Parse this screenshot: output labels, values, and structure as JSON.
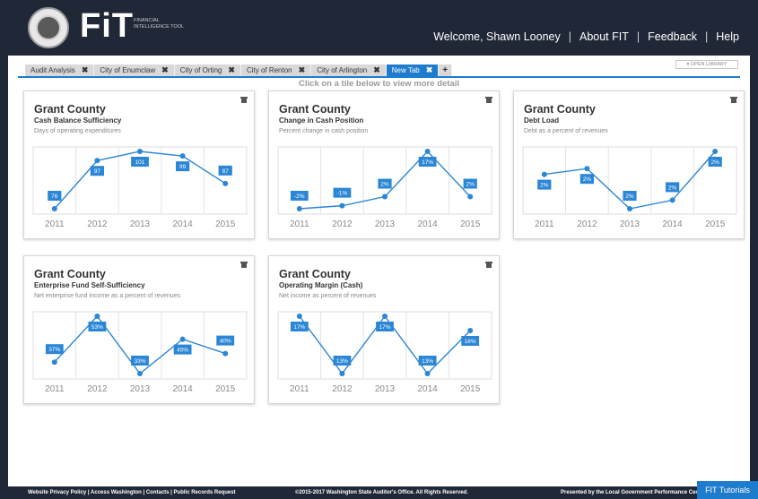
{
  "header": {
    "logo_text": "FiT",
    "logo_subtitle": "FINANCIAL INTELLIGENCE TOOL",
    "nav": [
      "Welcome, Shawn Looney",
      "About FIT",
      "Feedback",
      "Help"
    ],
    "open_library": "▾ OPEN LIBRARY"
  },
  "tabs": [
    {
      "label": "Audit Analysis",
      "close": "✖"
    },
    {
      "label": "City of Enumclaw",
      "close": "✖"
    },
    {
      "label": "City of Orting",
      "close": "✖"
    },
    {
      "label": "City of Renton",
      "close": "✖"
    },
    {
      "label": "City of Arlington",
      "close": "✖"
    },
    {
      "label": "New Tab",
      "close": "✖"
    }
  ],
  "add_tab": "+",
  "hint": "Click on a tile below to view more detail",
  "chart_data": [
    {
      "type": "line",
      "title": "Grant County",
      "subtitle": "Cash Balance Sufficiency",
      "description": "Days of operating expenditures",
      "x": [
        "2011",
        "2012",
        "2013",
        "2014",
        "2015"
      ],
      "values": [
        76,
        97,
        101,
        99,
        87
      ],
      "labels": [
        "76",
        "97",
        "101",
        "99",
        "87"
      ]
    },
    {
      "type": "line",
      "title": "Grant County",
      "subtitle": "Change in Cash Position",
      "description": "Percent change in cash position",
      "x": [
        "2011",
        "2012",
        "2013",
        "2014",
        "2015"
      ],
      "values": [
        -2,
        -1,
        2,
        17,
        2
      ],
      "labels": [
        "-2%",
        "-1%",
        "2%",
        "17%",
        "2%"
      ]
    },
    {
      "type": "line",
      "title": "Grant County",
      "subtitle": "Debt Load",
      "description": "Debt as a percent of revenues",
      "x": [
        "2011",
        "2012",
        "2013",
        "2014",
        "2015"
      ],
      "values": [
        2.35,
        2.45,
        1.75,
        1.9,
        2.75
      ],
      "labels": [
        "2%",
        "2%",
        "2%",
        "2%",
        "2%"
      ]
    },
    {
      "type": "line",
      "title": "Grant County",
      "subtitle": "Enterprise Fund Self-Sufficiency",
      "description": "Net enterprise fund income as a percent of revenues",
      "x": [
        "2011",
        "2012",
        "2013",
        "2014",
        "2015"
      ],
      "values": [
        37,
        53,
        33,
        45,
        40
      ],
      "labels": [
        "37%",
        "53%",
        "33%",
        "45%",
        "40%"
      ]
    },
    {
      "type": "line",
      "title": "Grant County",
      "subtitle": "Operating Margin (Cash)",
      "description": "Net income as percent of revenues",
      "x": [
        "2011",
        "2012",
        "2013",
        "2014",
        "2015"
      ],
      "values": [
        17,
        13,
        17,
        13,
        16
      ],
      "labels": [
        "17%",
        "13%",
        "17%",
        "13%",
        "16%"
      ]
    }
  ],
  "footer": {
    "left": "Website Privacy Policy  |  Access Washington  |  Contacts  |  Public Records Request",
    "mid": "©2015-2017 Washington State Auditor's Office. All Rights Reserved.",
    "right": "Presented by the Local Government Performance Center",
    "tutorials": "FIT Tutorials"
  },
  "colors": {
    "accent": "#1e7ccf",
    "header_bg": "#202737"
  }
}
